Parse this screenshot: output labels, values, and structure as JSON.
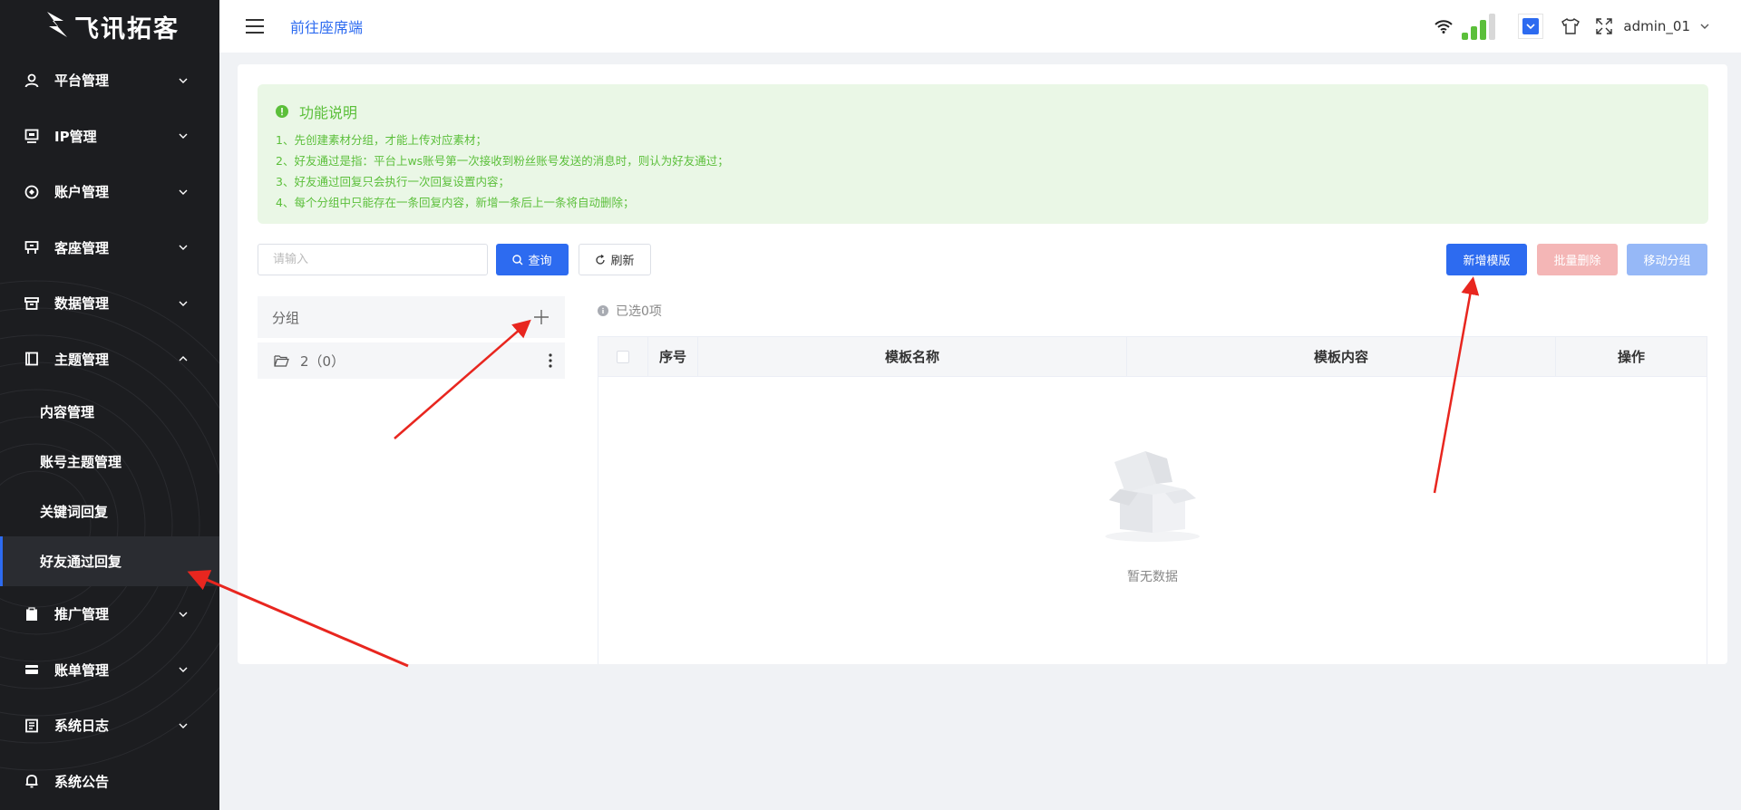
{
  "brand": {
    "name": "飞讯拓客"
  },
  "sidebar": {
    "items": [
      {
        "label": "平台管理",
        "icon": "user-icon",
        "expanded": false
      },
      {
        "label": "IP管理",
        "icon": "monitor-icon",
        "expanded": false
      },
      {
        "label": "账户管理",
        "icon": "account-icon",
        "expanded": false
      },
      {
        "label": "客座管理",
        "icon": "seat-icon",
        "expanded": false
      },
      {
        "label": "数据管理",
        "icon": "archive-icon",
        "expanded": false
      },
      {
        "label": "主题管理",
        "icon": "book-icon",
        "expanded": true
      },
      {
        "label": "推广管理",
        "icon": "clipboard-icon",
        "expanded": false
      },
      {
        "label": "账单管理",
        "icon": "card-icon",
        "expanded": false
      },
      {
        "label": "系统日志",
        "icon": "log-icon",
        "expanded": false
      },
      {
        "label": "系统公告",
        "icon": "bell-icon",
        "expanded": false
      }
    ],
    "sub_items": [
      {
        "label": "内容管理",
        "active": false
      },
      {
        "label": "账号主题管理",
        "active": false
      },
      {
        "label": "关键词回复",
        "active": false
      },
      {
        "label": "好友通过回复",
        "active": true
      }
    ]
  },
  "header": {
    "portal_link": "前往座席端",
    "username": "admin_01"
  },
  "notice": {
    "title": "功能说明",
    "lines": [
      "1、先创建素材分组，才能上传对应素材；",
      "2、好友通过是指：平台上ws账号第一次接收到粉丝账号发送的消息时，则认为好友通过；",
      "3、好友通过回复只会执行一次回复设置内容；",
      "4、每个分组中只能存在一条回复内容，新增一条后上一条将自动删除；"
    ]
  },
  "toolbar": {
    "search_placeholder": "请输入",
    "query_label": "查询",
    "refresh_label": "刷新",
    "add_label": "新增模版",
    "batch_delete_label": "批量删除",
    "move_group_label": "移动分组"
  },
  "groups": {
    "header": "分组",
    "items": [
      {
        "label": "2（0）"
      }
    ]
  },
  "table": {
    "selected_text": "已选0项",
    "columns": [
      "序号",
      "模板名称",
      "模板内容",
      "操作"
    ],
    "empty_text": "暂无数据"
  },
  "colors": {
    "primary": "#2d6bf0",
    "sidebar_bg": "#1c1d20",
    "notice_bg": "#eaf7e6",
    "notice_text": "#5bbf3a",
    "arrow": "#e8261f"
  }
}
